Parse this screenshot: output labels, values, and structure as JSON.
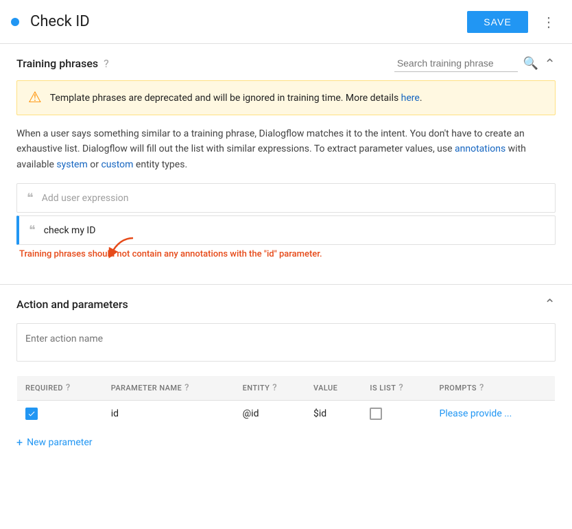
{
  "header": {
    "title": "Check ID",
    "save_label": "SAVE",
    "dot_color": "#2196F3"
  },
  "training_phrases": {
    "section_title": "Training phrases",
    "search_placeholder": "Search training phrase",
    "warning": {
      "text": "Template phrases are deprecated and will be ignored in training time. More details ",
      "link_text": "here",
      "link_url": "#"
    },
    "description_parts": [
      "When a user says something similar to a training phrase, Dialogflow matches it to the intent. You don't have to create an exhaustive list. Dialogflow will fill out the list with similar expressions. To extract parameter values, use ",
      " with available ",
      " or ",
      " entity types."
    ],
    "annotations_link": "annotations",
    "system_link": "system",
    "custom_link": "custom",
    "add_placeholder": "Add user expression",
    "phrase": "check my ID",
    "error_message": "Training phrases should not contain any annotations with the \"id\" parameter."
  },
  "action_parameters": {
    "section_title": "Action and parameters",
    "action_placeholder": "Enter action name",
    "table": {
      "columns": [
        {
          "id": "required",
          "label": "REQUIRED",
          "has_help": true
        },
        {
          "id": "param_name",
          "label": "PARAMETER NAME",
          "has_help": true
        },
        {
          "id": "entity",
          "label": "ENTITY",
          "has_help": true
        },
        {
          "id": "value",
          "label": "VALUE",
          "has_help": false
        },
        {
          "id": "is_list",
          "label": "IS LIST",
          "has_help": true
        },
        {
          "id": "prompts",
          "label": "PROMPTS",
          "has_help": true
        }
      ],
      "rows": [
        {
          "required": true,
          "param_name": "id",
          "entity": "@id",
          "value": "$id",
          "is_list": false,
          "prompts_text": "Please provide ..."
        }
      ]
    }
  },
  "new_parameter": {
    "label": "New parameter",
    "plus": "+"
  }
}
